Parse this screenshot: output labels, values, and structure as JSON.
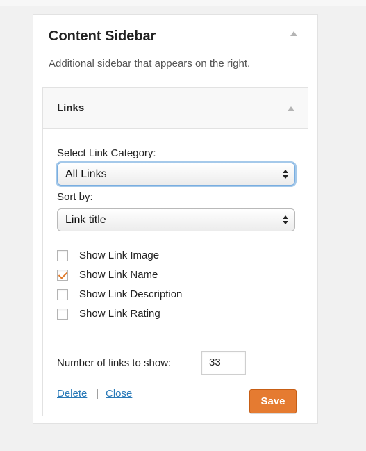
{
  "sidebar": {
    "title": "Content Sidebar",
    "description": "Additional sidebar that appears on the right."
  },
  "widget": {
    "title": "Links",
    "category_label": "Select Link Category:",
    "category_value": "All Links",
    "sort_label": "Sort by:",
    "sort_value": "Link title",
    "options": [
      {
        "label": "Show Link Image",
        "checked": false
      },
      {
        "label": "Show Link Name",
        "checked": true
      },
      {
        "label": "Show Link Description",
        "checked": false
      },
      {
        "label": "Show Link Rating",
        "checked": false
      }
    ],
    "number_label": "Number of links to show:",
    "number_value": "33",
    "delete_label": "Delete",
    "separator": "|",
    "close_label": "Close",
    "save_label": "Save"
  },
  "colors": {
    "accent": "#e57b31",
    "link": "#2a7ab8",
    "background": "#f1f1f1"
  }
}
